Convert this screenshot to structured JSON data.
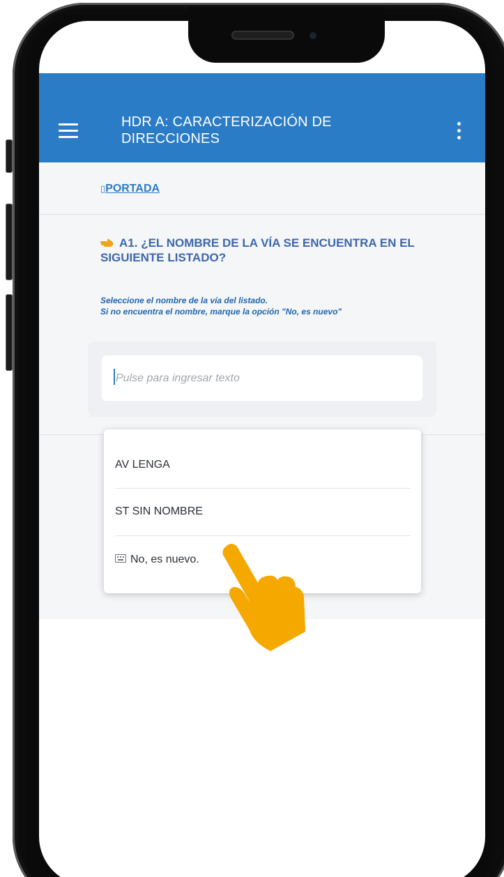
{
  "header": {
    "title": "HDR A: CARACTERIZACIÓN DE DIRECCIONES",
    "menu_icon": "hamburger-menu-icon",
    "more_icon": "more-vertical-icon",
    "color": "#2a7cc7"
  },
  "breadcrumb": {
    "icon": "▯",
    "label": "PORTADA"
  },
  "question": {
    "icon": "pointing-hand-icon",
    "text": "A1. ¿EL NOMBRE DE LA VÍA SE ENCUENTRA EN EL SIGUIENTE LISTADO?"
  },
  "help": {
    "line1": "Seleccione el nombre de la vía del listado.",
    "line2": "Si no encuentra el nombre, marque la opción \"No, es nuevo\""
  },
  "input": {
    "placeholder": "Pulse para ingresar texto",
    "value": ""
  },
  "dropdown": {
    "options": [
      {
        "label": "AV LENGA"
      },
      {
        "label": "ST SIN NOMBRE"
      },
      {
        "label": "No, es nuevo.",
        "icon": "keyboard-icon"
      }
    ]
  },
  "overlay": {
    "pointer": "tap-hand-icon",
    "color": "#f5a800"
  }
}
